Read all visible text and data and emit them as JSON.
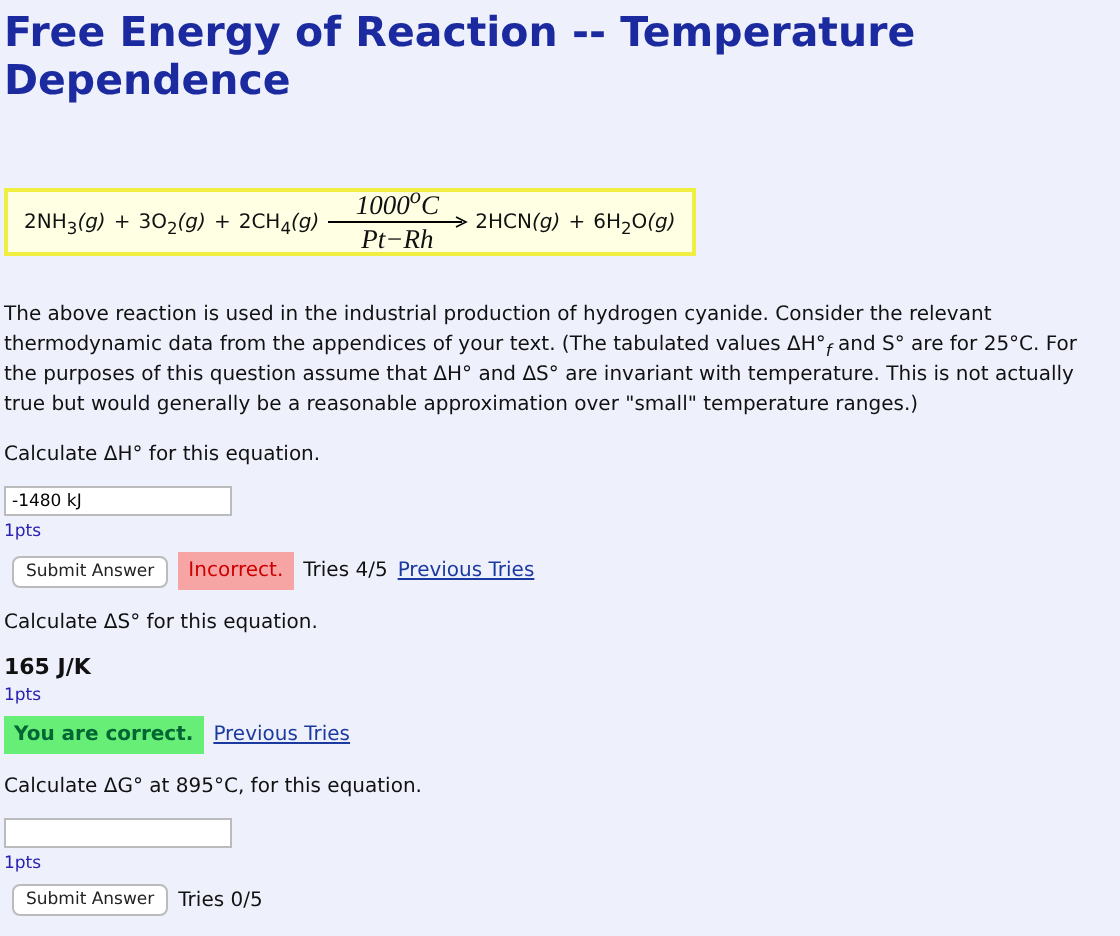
{
  "title": "Free Energy of Reaction -- Temperature Dependence",
  "equation": {
    "reactants": [
      {
        "formula": "2NH$_{3}$",
        "state": "(g)"
      },
      {
        "joiner": "+",
        "formula": "3O$_{2}$",
        "state": "(g)"
      },
      {
        "joiner": "+",
        "formula": "2CH$_{4}$",
        "state": "(g)"
      }
    ],
    "condition_above": "1000$^{o}$C",
    "condition_below": "Pt−Rh",
    "products": [
      {
        "formula": "2HCN",
        "state": "(g)"
      },
      {
        "joiner": "+",
        "formula": "6H$_{2}$O",
        "state": "(g)"
      }
    ]
  },
  "intro": "The above reaction is used in the industrial production of hydrogen cyanide. Consider the relevant thermodynamic data from the appendices of your text. (The tabulated values ΔH°$_{f}$ and S° are for 25°C. For the purposes of this question assume that ΔH° and ΔS° are invariant with temperature. This is not actually true but would generally be a reasonable approximation over \"small\" temperature ranges.)",
  "questions": [
    {
      "prompt": "Calculate ΔH° for this equation.",
      "kind": "input",
      "value": "-1480 kJ",
      "points": "1pts",
      "button": "Submit Answer",
      "feedback": {
        "text": "Incorrect.",
        "correct": false
      },
      "tries": "Tries 4/5",
      "link": "Previous Tries"
    },
    {
      "prompt": "Calculate ΔS° for this equation.",
      "kind": "answered",
      "answer": "165 J/K",
      "points": "1pts",
      "feedback": {
        "text": "You are correct.",
        "correct": true
      },
      "link": "Previous Tries"
    },
    {
      "prompt": "Calculate ΔG° at 895°C, for this equation.",
      "kind": "input",
      "points": "1pts",
      "button": "Submit Answer",
      "tries": "Tries 0/5"
    }
  ]
}
